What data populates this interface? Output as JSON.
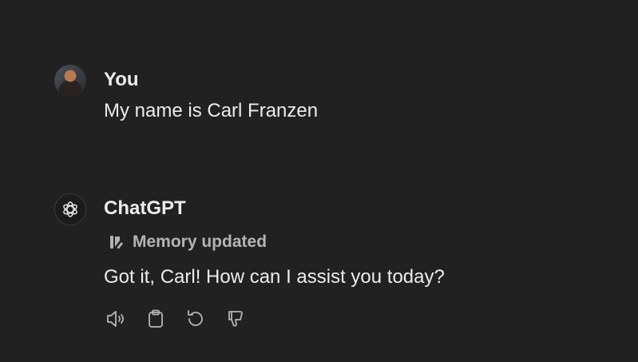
{
  "messages": {
    "user": {
      "author": "You",
      "text": "My name is Carl Franzen"
    },
    "assistant": {
      "author": "ChatGPT",
      "memory_notice": "Memory updated",
      "text": "Got it, Carl! How can I assist you today?"
    }
  },
  "actions": [
    {
      "icon": "speaker-icon",
      "name": "read-aloud"
    },
    {
      "icon": "clipboard-icon",
      "name": "copy"
    },
    {
      "icon": "regenerate-icon",
      "name": "regenerate"
    },
    {
      "icon": "thumbs-down-icon",
      "name": "bad-response"
    }
  ],
  "colors": {
    "background": "#212121",
    "text": "#ececec",
    "muted": "#b4b4b4"
  }
}
